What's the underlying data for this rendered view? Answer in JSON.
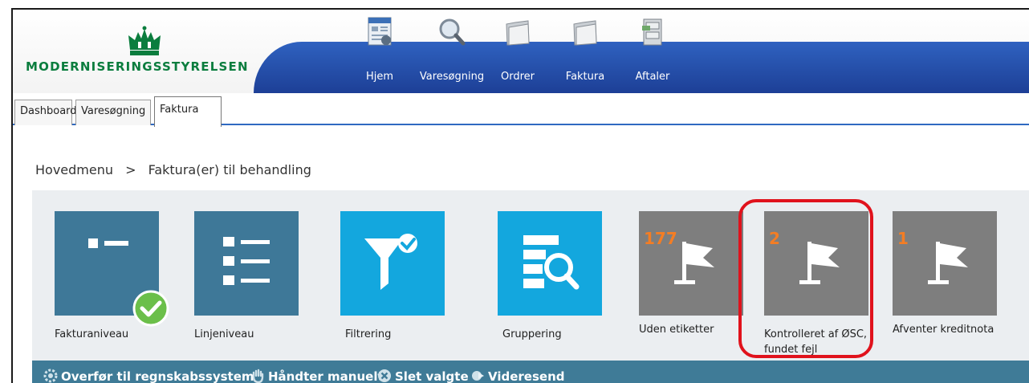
{
  "logo": {
    "text": "Moderniseringsstyrelsen",
    "display": "MODERNISERINGSSTYRELSEN"
  },
  "nav": [
    {
      "label": "Hjem",
      "icon": "home-document-icon"
    },
    {
      "label": "Varesøgning",
      "icon": "magnifier-icon"
    },
    {
      "label": "Ordrer",
      "icon": "folder-icon"
    },
    {
      "label": "Faktura",
      "icon": "folder-icon"
    },
    {
      "label": "Aftaler",
      "icon": "cabinet-icon"
    }
  ],
  "tabs": [
    {
      "label": "Dashboard",
      "active": false
    },
    {
      "label": "Varesøgning",
      "active": false
    },
    {
      "label": "Faktura",
      "active": true
    }
  ],
  "breadcrumb": {
    "root": "Hovedmenu",
    "separator": ">",
    "current": "Faktura(er) til behandling"
  },
  "tiles": [
    {
      "label": "Fakturaniveau",
      "icon": "invoice-level-icon",
      "checked": true
    },
    {
      "label": "Linjeniveau",
      "icon": "line-list-icon"
    },
    {
      "label": "Filtrering",
      "icon": "filter-check-icon"
    },
    {
      "label": "Gruppering",
      "icon": "group-search-icon"
    },
    {
      "label": "Uden etiketter",
      "count": "177",
      "icon": "flag-icon"
    },
    {
      "label_line1": "Kontrolleret af ØSC,",
      "label_line2": "fundet fejl",
      "count": "2",
      "icon": "flag-icon"
    },
    {
      "label": "Afventer kreditnota",
      "count": "1",
      "icon": "flag-icon"
    }
  ],
  "actions": [
    {
      "label": "Overfør til regnskabssystem",
      "icon": "transfer-gear-icon"
    },
    {
      "label": "Håndter manuelt",
      "icon": "hand-icon"
    },
    {
      "label": "Slet valgte",
      "icon": "delete-circle-icon"
    },
    {
      "label": "Videresend",
      "icon": "forward-icon"
    }
  ],
  "colors": {
    "navbar": "#2f62c0",
    "tile_blue": "#3e7898",
    "tile_cyan": "#13a7de",
    "tile_grey": "#7e7e7e",
    "count_orange": "#f47d24",
    "highlight_red": "#e0121c",
    "actionbar": "#3f7b97",
    "logo_green": "#0b7d3e"
  }
}
